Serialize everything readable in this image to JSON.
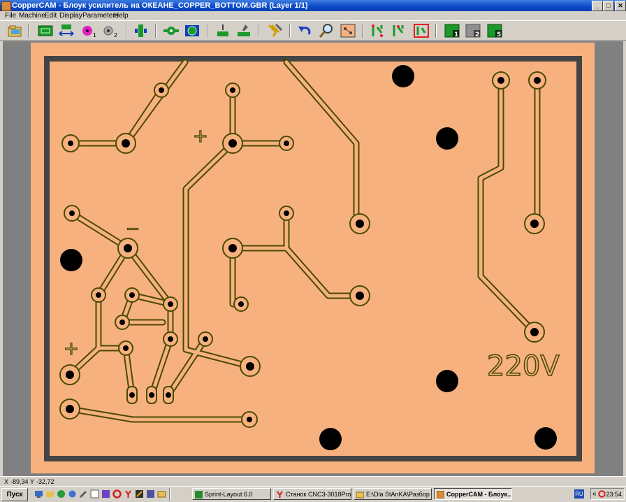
{
  "window": {
    "title": "CopperCAM  -  Блоук усилитель на ОКЕАНЕ_COPPER_BOTTOM.GBR   (Layer 1/1)",
    "min": "_",
    "max": "□",
    "close": "✕"
  },
  "menu": [
    "File",
    "Machine",
    "Edit",
    "Display",
    "Parameters",
    "Help"
  ],
  "toolbar": {
    "hole_label_1": "1",
    "hole_label_2": "2",
    "layer_1": "1",
    "layer_2": "2",
    "layer_5": "5"
  },
  "board": {
    "text_220v": "220V",
    "plus_1": "+",
    "plus_2": "+",
    "minus": "−"
  },
  "colors": {
    "board": "#f7b17f",
    "border": "#444444",
    "trace_fill": "#f7b17f",
    "trace_outline": "#4a4a00",
    "hole": "#000000",
    "workspace": "#808080"
  },
  "status": {
    "x_label": "X",
    "x_value": "-89,34",
    "y_label": "Y",
    "y_value": "-32,72"
  },
  "taskbar": {
    "start": "Пуск",
    "tasks": [
      "Sprint-Layout 6.0",
      "Станок CNC3-3018Pro •...",
      "E:\\Dla StAnKA\\Разбор п...",
      "CopperCAM  -  Блоук..."
    ],
    "lang": "RU",
    "collapse": "«",
    "clock": "23:54"
  }
}
